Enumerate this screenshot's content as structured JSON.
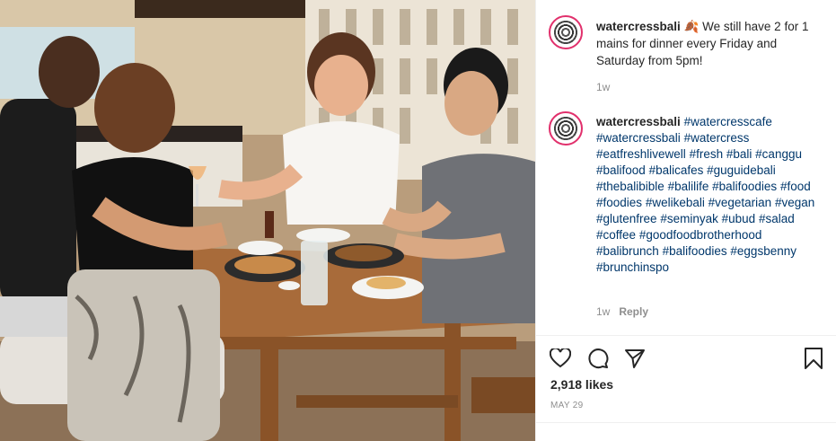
{
  "post": {
    "username": "watercressbali",
    "caption_emoji": "🍂",
    "caption_text": "We still have 2 for 1 mains for dinner every Friday and Saturday from 5pm!",
    "caption_time": "1w"
  },
  "comment": {
    "username": "watercressbali",
    "hashtags": [
      "#watercresscafe",
      "#watercressbali",
      "#watercress",
      "#eatfreshlivewell",
      "#fresh",
      "#bali",
      "#canggu",
      "#balifood",
      "#balicafes",
      "#guguidebali",
      "#thebalibible",
      "#balilife",
      "#balifoodies",
      "#food",
      "#foodies",
      "#welikebali",
      "#vegetarian",
      "#vegan",
      "#glutenfree",
      "#seminyak",
      "#ubud",
      "#salad",
      "#coffee",
      "#goodfoodbrotherhood",
      "#balibrunch",
      "#balifoodies",
      "#eggsbenny",
      "#brunchinspo"
    ],
    "time": "1w",
    "reply_label": "Reply"
  },
  "actions": {
    "icons": [
      "heart-icon",
      "comment-icon",
      "share-icon",
      "bookmark-icon"
    ]
  },
  "stats": {
    "likes": "2,918 likes",
    "date": "MAY 29"
  }
}
